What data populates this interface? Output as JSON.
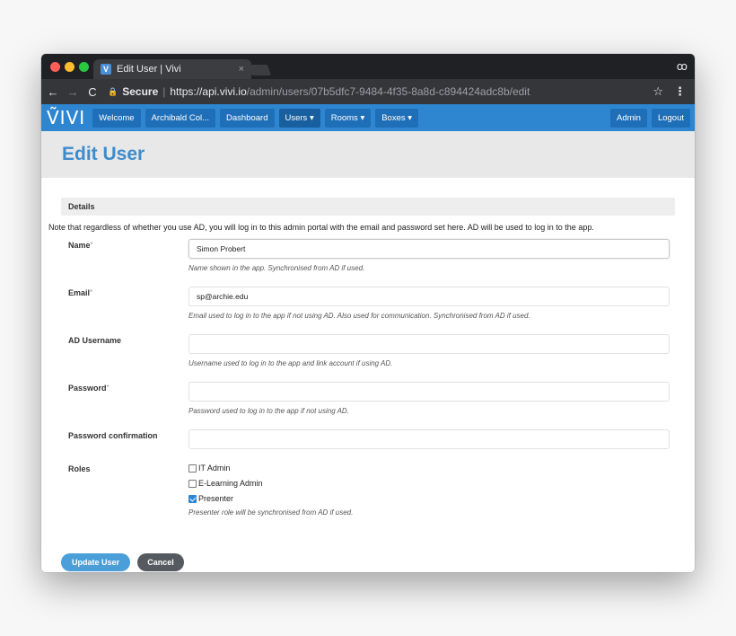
{
  "browser": {
    "tab_title": "Edit User | Vivi",
    "tab_close": "×",
    "favicon": "V",
    "secure_label": "Secure",
    "url_host": "https://api.vivi.io",
    "url_path": "/admin/users/07b5dfc7-9484-4f35-8a8d-c894424adc8b/edit",
    "incognito_icon": "ꝏ",
    "back_icon": "←",
    "forward_icon": "→",
    "reload_icon": "C",
    "star_icon": "☆",
    "menu_icon": "⋮"
  },
  "appnav": {
    "logo": "ṼIVI",
    "items": [
      {
        "label": "Welcome"
      },
      {
        "label": "Archibald Col..."
      },
      {
        "label": "Dashboard"
      },
      {
        "label": "Users ▾"
      },
      {
        "label": "Rooms ▾"
      },
      {
        "label": "Boxes ▾"
      }
    ],
    "right_items": [
      {
        "label": "Admin"
      },
      {
        "label": "Logout"
      }
    ],
    "accent": "#2e86d1"
  },
  "page": {
    "title": "Edit User"
  },
  "form": {
    "section_heading": "Details",
    "note": "Note that regardless of whether you use AD, you will log in to this admin portal with the email and password set here. AD will be used to log in to the app.",
    "required_mark": "*",
    "name": {
      "label": "Name",
      "value": "Simon Probert",
      "help": "Name shown in the app. Synchronised from AD if used."
    },
    "email": {
      "label": "Email",
      "value": "sp@archie.edu",
      "help": "Email used to log in to the app if not using AD. Also used for communication. Synchronised from AD if used."
    },
    "ad_username": {
      "label": "AD Username",
      "value": "",
      "help": "Username used to log in to the app and link account if using AD."
    },
    "password": {
      "label": "Password",
      "value": "",
      "help": "Password used to log in to the app if not using AD."
    },
    "password_confirmation": {
      "label": "Password confirmation",
      "value": ""
    },
    "roles": {
      "label": "Roles",
      "options": [
        {
          "label": "IT Admin",
          "checked": false
        },
        {
          "label": "E-Learning Admin",
          "checked": false
        },
        {
          "label": "Presenter",
          "checked": true
        }
      ],
      "help": "Presenter role will be synchronised from AD if used."
    },
    "submit_label": "Update User",
    "cancel_label": "Cancel"
  }
}
